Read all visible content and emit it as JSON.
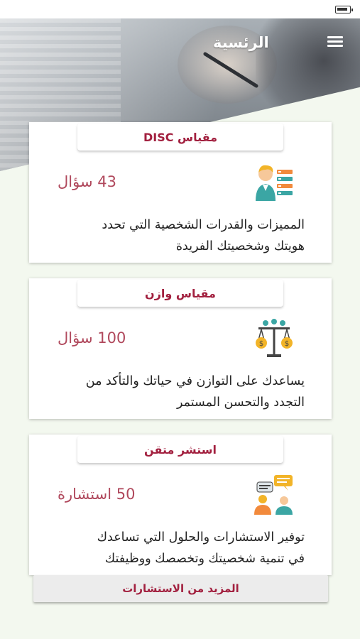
{
  "header": {
    "title": "الرئسية",
    "menu_icon": "hamburger-menu-icon"
  },
  "cards": [
    {
      "title": "مقياس DISC",
      "count": "43 سؤال",
      "description_line1": "المميزات والقدرات الشخصية التي تحدد",
      "description_line2": "هويتك وشخصيتك الفريدة",
      "icon": "person-profile-icon"
    },
    {
      "title": "مقياس وازن",
      "count": "100 سؤال",
      "description_line1": "يساعدك على التوازن في حياتك والتأكد من",
      "description_line2": "التجدد والتحسن المستمر",
      "icon": "balance-scale-icon"
    },
    {
      "title": "استشر متقن",
      "count": "50 استشارة",
      "description_line1": "توفير الاستشارات والحلول التي تساعدك",
      "description_line2": "في تنمية شخصيتك وتخصصك ووظيفتك",
      "icon": "consultation-chat-icon"
    }
  ],
  "more_button": {
    "label": "المزيد من الاستشارات"
  },
  "colors": {
    "accent": "#a2203f",
    "count_text": "#b0485c",
    "background": "#f3f8ef"
  }
}
